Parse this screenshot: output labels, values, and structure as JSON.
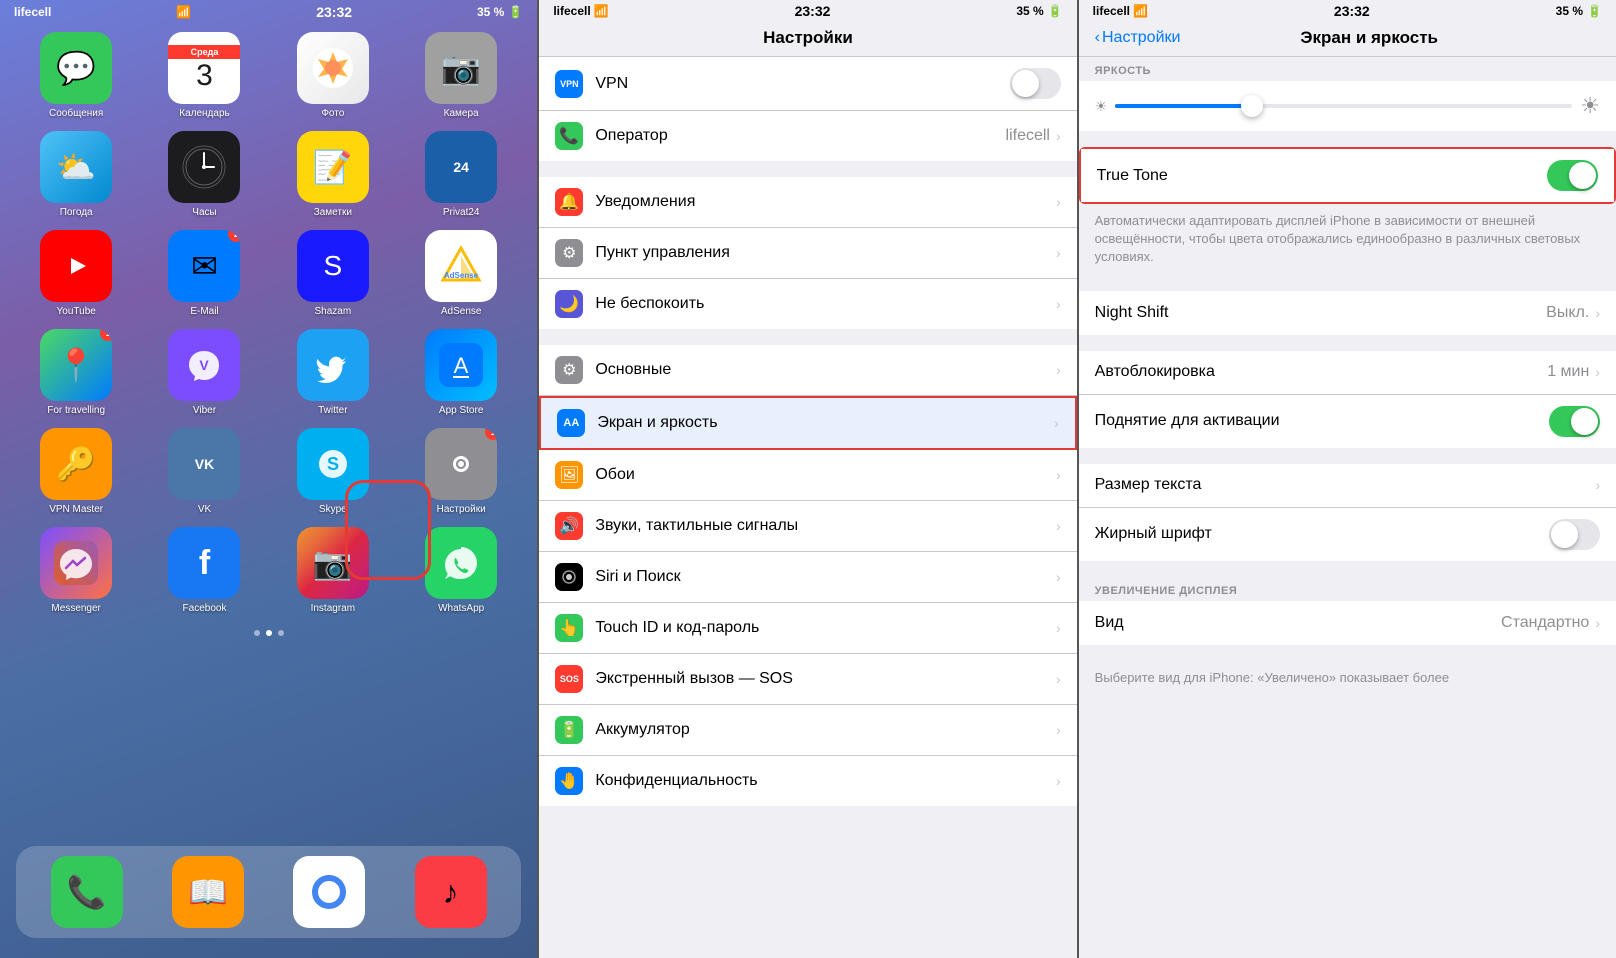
{
  "panel1": {
    "status": {
      "carrier": "lifecell",
      "wifi": true,
      "time": "23:32",
      "battery": "35 %"
    },
    "apps": [
      {
        "id": "messages",
        "label": "Сообщения",
        "colorClass": "app-messages",
        "icon": "💬",
        "badge": null
      },
      {
        "id": "calendar",
        "label": "Календарь",
        "colorClass": "app-calendar",
        "icon": "",
        "badge": null,
        "special": "calendar",
        "dayName": "Среда",
        "dayNum": "3"
      },
      {
        "id": "photos",
        "label": "Фото",
        "colorClass": "app-photos",
        "icon": "🌷",
        "badge": null
      },
      {
        "id": "camera",
        "label": "Камера",
        "colorClass": "app-camera",
        "icon": "📷",
        "badge": null
      },
      {
        "id": "weather",
        "label": "Погода",
        "colorClass": "app-weather",
        "icon": "⛅",
        "badge": null
      },
      {
        "id": "clock",
        "label": "Часы",
        "colorClass": "app-clock",
        "icon": "🕙",
        "badge": null
      },
      {
        "id": "notes",
        "label": "Заметки",
        "colorClass": "app-notes",
        "icon": "📝",
        "badge": null
      },
      {
        "id": "privat24",
        "label": "Privat24",
        "colorClass": "app-privat24",
        "icon": "24",
        "badge": null
      },
      {
        "id": "youtube",
        "label": "YouTube",
        "colorClass": "app-youtube",
        "icon": "▶",
        "badge": null
      },
      {
        "id": "email",
        "label": "E-Mail",
        "colorClass": "app-email",
        "icon": "✉",
        "badge": "2"
      },
      {
        "id": "shazam",
        "label": "Shazam",
        "colorClass": "app-shazam",
        "icon": "S",
        "badge": null
      },
      {
        "id": "adsense",
        "label": "AdSense",
        "colorClass": "app-adsense",
        "icon": "▲",
        "badge": null
      },
      {
        "id": "maps",
        "label": "For travelling",
        "colorClass": "app-maps",
        "icon": "📍",
        "badge": "1"
      },
      {
        "id": "viber",
        "label": "Viber",
        "colorClass": "app-viber",
        "icon": "📞",
        "badge": null
      },
      {
        "id": "twitter",
        "label": "Twitter",
        "colorClass": "app-twitter",
        "icon": "🐦",
        "badge": null
      },
      {
        "id": "appstore",
        "label": "App Store",
        "colorClass": "app-appstore",
        "icon": "A",
        "badge": null
      },
      {
        "id": "vpnmaster",
        "label": "VPN Master",
        "colorClass": "app-vpnmaster",
        "icon": "🔑",
        "badge": null
      },
      {
        "id": "vk",
        "label": "VK",
        "colorClass": "app-vk",
        "icon": "VK",
        "badge": null
      },
      {
        "id": "skype",
        "label": "Skype",
        "colorClass": "app-skype",
        "icon": "S",
        "badge": null
      },
      {
        "id": "settings",
        "label": "Настройки",
        "colorClass": "app-settings",
        "icon": "⚙",
        "badge": "1"
      },
      {
        "id": "messenger",
        "label": "Messenger",
        "colorClass": "app-messenger",
        "icon": "💬",
        "badge": null
      },
      {
        "id": "facebook",
        "label": "Facebook",
        "colorClass": "app-facebook",
        "icon": "f",
        "badge": null
      },
      {
        "id": "instagram",
        "label": "Instagram",
        "colorClass": "app-instagram",
        "icon": "📷",
        "badge": null
      },
      {
        "id": "whatsapp",
        "label": "WhatsApp",
        "colorClass": "app-whatsapp",
        "icon": "💬",
        "badge": null
      }
    ],
    "dock": [
      {
        "id": "phone",
        "label": "Телефон",
        "colorClass": "app-messages",
        "icon": "📞"
      },
      {
        "id": "books",
        "label": "Книги",
        "colorClass": "app-notes",
        "icon": "📖"
      },
      {
        "id": "chrome",
        "label": "Chrome",
        "colorClass": "app-youtube",
        "icon": "●"
      },
      {
        "id": "music",
        "label": "Музыка",
        "colorClass": "app-appstore",
        "icon": "♪"
      }
    ]
  },
  "panel2": {
    "status": {
      "carrier": "lifecell",
      "time": "23:32",
      "battery": "35 %"
    },
    "title": "Настройки",
    "rows": [
      {
        "id": "vpn",
        "label": "VPN",
        "value": "",
        "hasToggle": true,
        "toggleOn": false,
        "hasChevron": false,
        "iconColor": "#007aff",
        "icon": "VPN",
        "specialVPN": true
      },
      {
        "id": "operator",
        "label": "Оператор",
        "value": "lifecell",
        "hasToggle": false,
        "hasChevron": true,
        "iconColor": "#34c759",
        "icon": "📞"
      },
      {
        "id": "notifications",
        "label": "Уведомления",
        "value": "",
        "hasToggle": false,
        "hasChevron": true,
        "iconColor": "#ff3b30",
        "icon": "🔔"
      },
      {
        "id": "control",
        "label": "Пункт управления",
        "value": "",
        "hasToggle": false,
        "hasChevron": true,
        "iconColor": "#8e8e93",
        "icon": "⚙"
      },
      {
        "id": "dnd",
        "label": "Не беспокоить",
        "value": "",
        "hasToggle": false,
        "hasChevron": true,
        "iconColor": "#5856d6",
        "icon": "🌙"
      },
      {
        "id": "general",
        "label": "Основные",
        "value": "",
        "hasToggle": false,
        "hasChevron": true,
        "iconColor": "#8e8e93",
        "icon": "⚙"
      },
      {
        "id": "display",
        "label": "Экран и яркость",
        "value": "",
        "hasToggle": false,
        "hasChevron": true,
        "iconColor": "#007aff",
        "icon": "AA",
        "highlighted": true
      },
      {
        "id": "wallpaper",
        "label": "Обои",
        "value": "",
        "hasToggle": false,
        "hasChevron": true,
        "iconColor": "#ff9500",
        "icon": "🖼"
      },
      {
        "id": "sounds",
        "label": "Звуки, тактильные сигналы",
        "value": "",
        "hasToggle": false,
        "hasChevron": true,
        "iconColor": "#ff3b30",
        "icon": "🔊"
      },
      {
        "id": "siri",
        "label": "Siri и Поиск",
        "value": "",
        "hasToggle": false,
        "hasChevron": true,
        "iconColor": "#000",
        "icon": "◉"
      },
      {
        "id": "touchid",
        "label": "Touch ID и код-пароль",
        "value": "",
        "hasToggle": false,
        "hasChevron": true,
        "iconColor": "#34c759",
        "icon": "👆"
      },
      {
        "id": "sos",
        "label": "Экстренный вызов — SOS",
        "value": "",
        "hasToggle": false,
        "hasChevron": true,
        "iconColor": "#ff3b30",
        "icon": "SOS"
      },
      {
        "id": "battery",
        "label": "Аккумулятор",
        "value": "",
        "hasToggle": false,
        "hasChevron": true,
        "iconColor": "#34c759",
        "icon": "🔋"
      },
      {
        "id": "privacy",
        "label": "Конфиденциальность",
        "value": "",
        "hasToggle": false,
        "hasChevron": true,
        "iconColor": "#007aff",
        "icon": "🤚"
      }
    ]
  },
  "panel3": {
    "status": {
      "carrier": "lifecell",
      "time": "23:32",
      "battery": "35 %"
    },
    "backLabel": "Настройки",
    "title": "Экран и яркость",
    "brightnessLabel": "ЯРКОСТЬ",
    "brightnessValue": 30,
    "rows": [
      {
        "id": "truetone",
        "label": "True Tone",
        "value": "",
        "hasToggle": true,
        "toggleOn": true,
        "hasChevron": false,
        "highlighted": true
      },
      {
        "id": "truetone-desc",
        "isDescription": true,
        "text": "Автоматически адаптировать дисплей iPhone в зависимости от внешней освещённости, чтобы цвета отображались единообразно в различных световых условиях."
      },
      {
        "id": "nightshift",
        "label": "Night Shift",
        "value": "Выкл.",
        "hasToggle": false,
        "hasChevron": true
      },
      {
        "id": "autobright",
        "label": "Автоблокировка",
        "value": "1 мин",
        "hasToggle": false,
        "hasChevron": true
      },
      {
        "id": "raisewake",
        "label": "Поднятие для активации",
        "value": "",
        "hasToggle": true,
        "toggleOn": true,
        "hasChevron": false
      },
      {
        "id": "textsize",
        "label": "Размер текста",
        "value": "",
        "hasToggle": false,
        "hasChevron": true
      },
      {
        "id": "bold",
        "label": "Жирный шрифт",
        "value": "",
        "hasToggle": true,
        "toggleOn": false,
        "hasChevron": false
      }
    ],
    "zoomSectionLabel": "УВЕЛИЧЕНИЕ ДИСПЛЕЯ",
    "zoomRows": [
      {
        "id": "view",
        "label": "Вид",
        "value": "Стандартно",
        "hasToggle": false,
        "hasChevron": true
      }
    ],
    "zoomDesc": "Выберите вид для iPhone: «Увеличено» показывает более"
  }
}
